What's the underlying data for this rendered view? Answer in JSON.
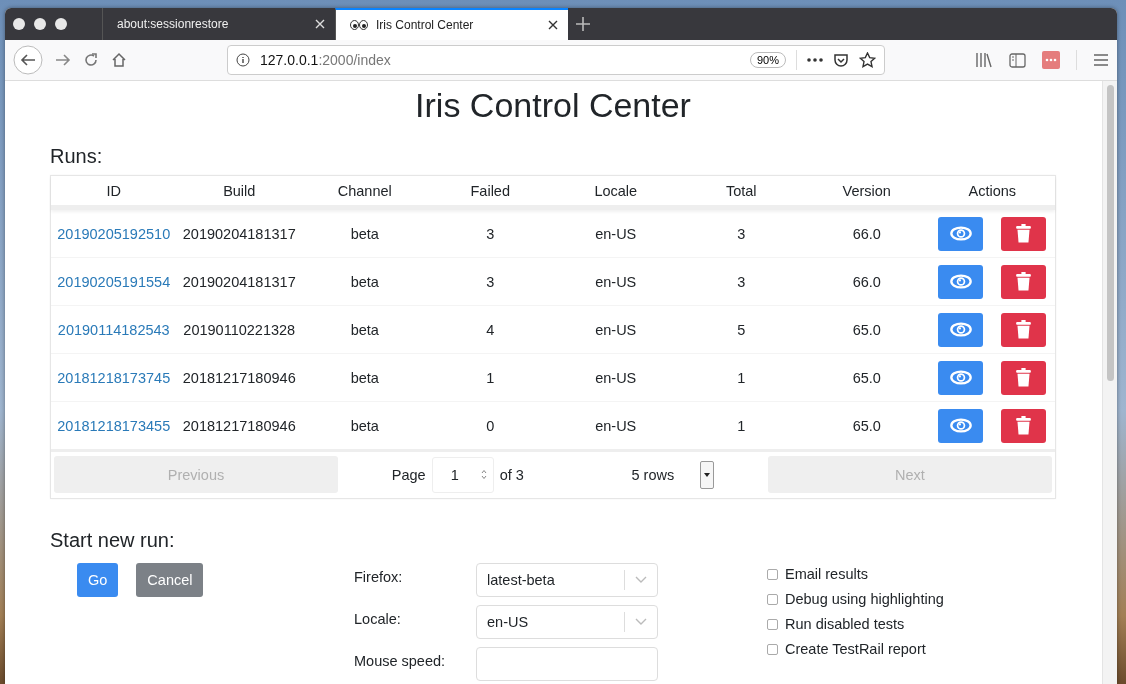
{
  "browser": {
    "tabs": [
      {
        "title": "about:sessionrestore",
        "selected": false,
        "kind": "plain"
      },
      {
        "title": "Iris Control Center",
        "selected": true,
        "kind": "eyes"
      }
    ],
    "url_host": "127.0.0.1",
    "url_rest": ":2000/index",
    "zoom": "90%"
  },
  "page": {
    "title": "Iris Control Center",
    "runs_heading": "Runs:",
    "table": {
      "columns": [
        "ID",
        "Build",
        "Channel",
        "Failed",
        "Locale",
        "Total",
        "Version",
        "Actions"
      ],
      "rows": [
        {
          "id": "20190205192510",
          "build": "20190204181317",
          "channel": "beta",
          "failed": "3",
          "locale": "en-US",
          "total": "3",
          "version": "66.0"
        },
        {
          "id": "20190205191554",
          "build": "20190204181317",
          "channel": "beta",
          "failed": "3",
          "locale": "en-US",
          "total": "3",
          "version": "66.0"
        },
        {
          "id": "20190114182543",
          "build": "20190110221328",
          "channel": "beta",
          "failed": "4",
          "locale": "en-US",
          "total": "5",
          "version": "65.0"
        },
        {
          "id": "20181218173745",
          "build": "20181217180946",
          "channel": "beta",
          "failed": "1",
          "locale": "en-US",
          "total": "1",
          "version": "65.0"
        },
        {
          "id": "20181218173455",
          "build": "20181217180946",
          "channel": "beta",
          "failed": "0",
          "locale": "en-US",
          "total": "1",
          "version": "65.0"
        }
      ],
      "pagination": {
        "previous": {
          "label": "Previous",
          "disabled": true
        },
        "page_label": "Page",
        "page": "1",
        "of": "of 3",
        "rows": "5 rows",
        "next": {
          "label": "Next",
          "disabled": true
        }
      }
    },
    "new_run": {
      "heading": "Start new run:",
      "buttons": [
        {
          "label": "Go",
          "kind": "primary"
        },
        {
          "label": "Cancel",
          "kind": "secondary"
        }
      ],
      "fields": [
        {
          "label": "Firefox:",
          "value": "latest-beta"
        },
        {
          "label": "Locale:",
          "value": "en-US"
        },
        {
          "label": "Mouse speed:"
        }
      ],
      "options": [
        {
          "label": "Email results",
          "checked": false
        },
        {
          "label": "Debug using highlighting",
          "checked": false
        },
        {
          "label": "Run disabled tests",
          "checked": false
        },
        {
          "label": "Create TestRail report",
          "checked": false
        }
      ]
    }
  }
}
